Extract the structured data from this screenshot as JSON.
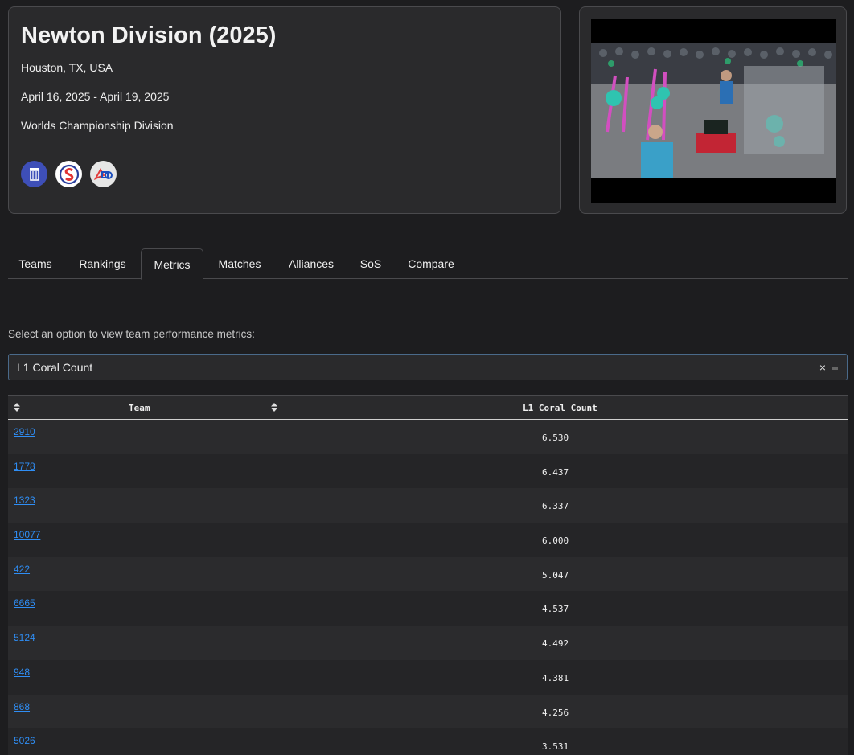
{
  "event": {
    "title": "Newton Division (2025)",
    "location": "Houston, TX, USA",
    "dates": "April 16, 2025 - April 19, 2025",
    "type": "Worlds Championship Division",
    "logos": [
      "frc-logo-icon",
      "statbotics-logo-icon",
      "first-logo-icon"
    ]
  },
  "video": {
    "icon": "match-video-thumbnail"
  },
  "tabs": [
    {
      "label": "Teams",
      "active": false
    },
    {
      "label": "Rankings",
      "active": false
    },
    {
      "label": "Metrics",
      "active": true
    },
    {
      "label": "Matches",
      "active": false
    },
    {
      "label": "Alliances",
      "active": false
    },
    {
      "label": "SoS",
      "active": false
    },
    {
      "label": "Compare",
      "active": false
    }
  ],
  "metrics": {
    "prompt": "Select an option to view team performance metrics:",
    "selected": "L1 Coral Count",
    "clear_symbol": "×"
  },
  "table": {
    "columns": [
      "Team",
      "L1 Coral Count"
    ],
    "rows": [
      {
        "team": "2910",
        "value": "6.530"
      },
      {
        "team": "1778",
        "value": "6.437"
      },
      {
        "team": "1323",
        "value": "6.337"
      },
      {
        "team": "10077",
        "value": "6.000"
      },
      {
        "team": "422",
        "value": "5.047"
      },
      {
        "team": "6665",
        "value": "4.537"
      },
      {
        "team": "5124",
        "value": "4.492"
      },
      {
        "team": "948",
        "value": "4.381"
      },
      {
        "team": "868",
        "value": "4.256"
      },
      {
        "team": "5026",
        "value": "3.531"
      }
    ]
  },
  "colors": {
    "accent_link": "#2f8ef5",
    "background": "#1d1d1f",
    "card": "#2a2a2c"
  }
}
